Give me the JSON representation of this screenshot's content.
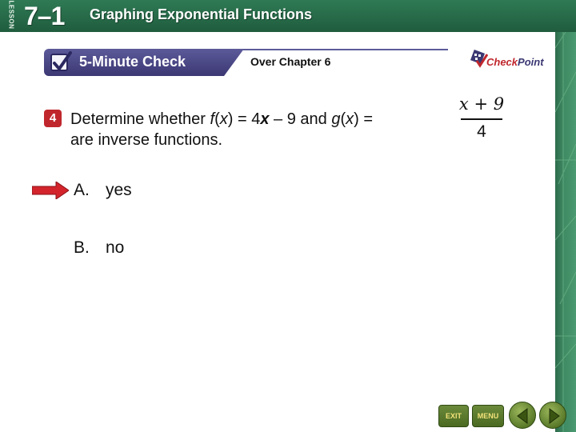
{
  "header": {
    "lesson_label": "LESSON",
    "lesson_number": "7–1",
    "title": "Graphing Exponential Functions"
  },
  "banner": {
    "title": "5-Minute Check",
    "chapter": "Over Chapter 6"
  },
  "logo": {
    "check": "Check",
    "point": "Point"
  },
  "question": {
    "number": "4",
    "line1_a": "Determine whether ",
    "f": "f",
    "paren_open": "(",
    "x1": "x",
    "paren_close_eq": ") = 4",
    "x2": "x",
    "mid": " – 9 and ",
    "g": "g",
    "paren_open2": "(",
    "x3": "x",
    "paren_close2": ") =",
    "line2": "are inverse functions.",
    "fraction_numerator": "x + 9",
    "fraction_denominator": "4"
  },
  "answers": [
    {
      "letter": "A.",
      "text": "yes",
      "correct": true
    },
    {
      "letter": "B.",
      "text": "no",
      "correct": false
    }
  ],
  "nav": {
    "exit_label": "EXIT",
    "menu_label": "MENU"
  },
  "colors": {
    "header_green": "#2f7a55",
    "banner_purple": "#4a4784",
    "accent_red": "#c0272d",
    "nav_green": "#5a7a2a"
  }
}
